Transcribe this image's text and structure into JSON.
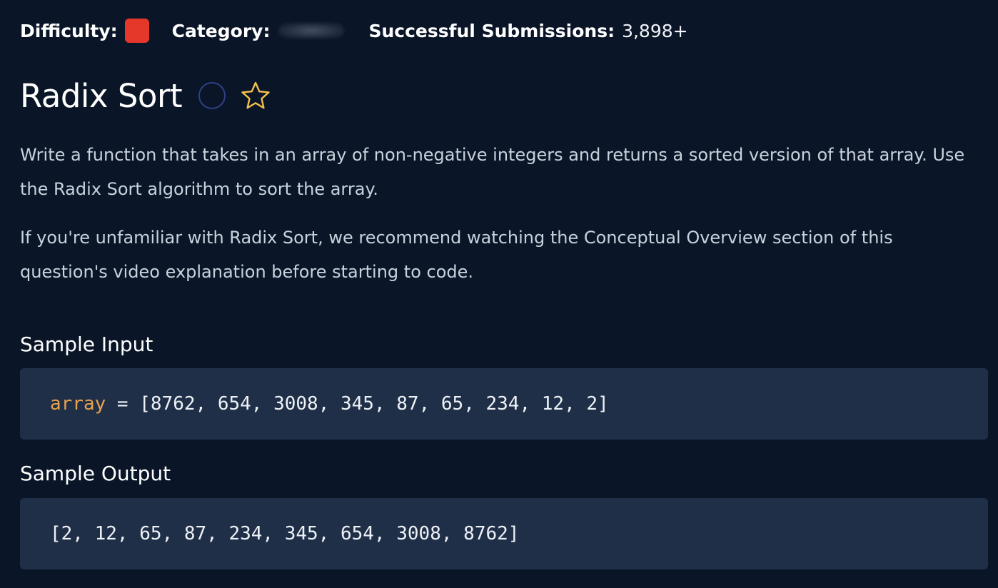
{
  "header": {
    "difficulty_label": "Difficulty:",
    "difficulty_color": "#e5382b",
    "category_label": "Category:",
    "submissions_label": "Successful Submissions:",
    "submissions_value": "3,898+"
  },
  "question": {
    "title": "Radix Sort",
    "status_icon": "circle-outline-icon",
    "favorite_icon": "star-outline-icon",
    "paragraphs": [
      "Write a function that takes in an array of non-negative integers and returns a sorted version of that array. Use the Radix Sort algorithm to sort the array.",
      "If you're unfamiliar with Radix Sort, we recommend watching the Conceptual Overview section of this question's video explanation before starting to code."
    ]
  },
  "sample_input": {
    "heading": "Sample Input",
    "variable": "array",
    "assignment": " = [8762, 654, 3008, 345, 87, 65, 234, 12, 2]"
  },
  "sample_output": {
    "heading": "Sample Output",
    "value": "[2, 12, 65, 87, 234, 345, 654, 3008, 8762]"
  },
  "colors": {
    "background": "#0a1628",
    "code_background": "#1f2f48",
    "code_variable": "#e8a24f",
    "star": "#f0c14b",
    "circle": "#2f3f86"
  }
}
